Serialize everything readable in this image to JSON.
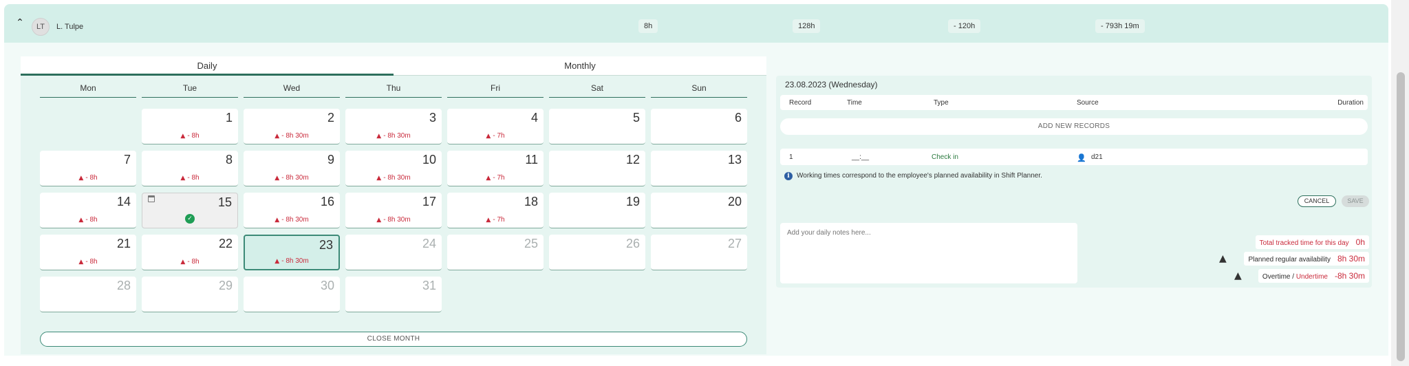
{
  "employee": {
    "initials": "LT",
    "name": "L. Tulpe",
    "stats": [
      "8h",
      "128h",
      "- 120h",
      "- 793h 19m"
    ]
  },
  "tabs": {
    "daily": "Daily",
    "monthly": "Monthly"
  },
  "weekdays": [
    "Mon",
    "Tue",
    "Wed",
    "Thu",
    "Fri",
    "Sat",
    "Sun"
  ],
  "calendar": {
    "days": [
      {
        "n": "1",
        "alert": "- 8h"
      },
      {
        "n": "2",
        "alert": "- 8h 30m"
      },
      {
        "n": "3",
        "alert": "- 8h 30m"
      },
      {
        "n": "4",
        "alert": "- 7h"
      },
      {
        "n": "5",
        "alert": ""
      },
      {
        "n": "6",
        "alert": ""
      },
      {
        "n": "7",
        "alert": "- 8h"
      },
      {
        "n": "8",
        "alert": "- 8h"
      },
      {
        "n": "9",
        "alert": "- 8h 30m"
      },
      {
        "n": "10",
        "alert": "- 8h 30m"
      },
      {
        "n": "11",
        "alert": "- 7h"
      },
      {
        "n": "12",
        "alert": ""
      },
      {
        "n": "13",
        "alert": ""
      },
      {
        "n": "14",
        "alert": "- 8h"
      },
      {
        "n": "15",
        "alert": ""
      },
      {
        "n": "16",
        "alert": "- 8h 30m"
      },
      {
        "n": "17",
        "alert": "- 8h 30m"
      },
      {
        "n": "18",
        "alert": "- 7h"
      },
      {
        "n": "19",
        "alert": ""
      },
      {
        "n": "20",
        "alert": ""
      },
      {
        "n": "21",
        "alert": "- 8h"
      },
      {
        "n": "22",
        "alert": "- 8h"
      },
      {
        "n": "23",
        "alert": "- 8h 30m"
      },
      {
        "n": "24",
        "alert": ""
      },
      {
        "n": "25",
        "alert": ""
      },
      {
        "n": "26",
        "alert": ""
      },
      {
        "n": "27",
        "alert": ""
      },
      {
        "n": "28",
        "alert": ""
      },
      {
        "n": "29",
        "alert": ""
      },
      {
        "n": "30",
        "alert": ""
      },
      {
        "n": "31",
        "alert": ""
      }
    ],
    "close_month": "CLOSE MONTH"
  },
  "detail": {
    "date_title": "23.08.2023 (Wednesday)",
    "columns": [
      "Record",
      "Time",
      "Type",
      "Source",
      "Duration"
    ],
    "add_new": "ADD NEW RECORDS",
    "record": {
      "index": "1",
      "time": "__:__",
      "type": "Check in",
      "source": "d21"
    },
    "info": "Working times correspond to the employee's planned availability in Shift Planner.",
    "cancel": "CANCEL",
    "save": "SAVE",
    "notes_placeholder": "Add your daily notes here...",
    "summary": {
      "tracked_label": "Total tracked time for this day",
      "tracked_value": "0h",
      "planned_label": "Planned regular availability",
      "planned_value": "8h 30m",
      "overtime_label": "Overtime",
      "slash": "/",
      "undertime_label": "Undertime",
      "overtime_value": "-8h 30m"
    }
  },
  "colors": {
    "accent": "#2d6f5c",
    "alert": "#c92a3b",
    "panel": "#d4efe9"
  }
}
